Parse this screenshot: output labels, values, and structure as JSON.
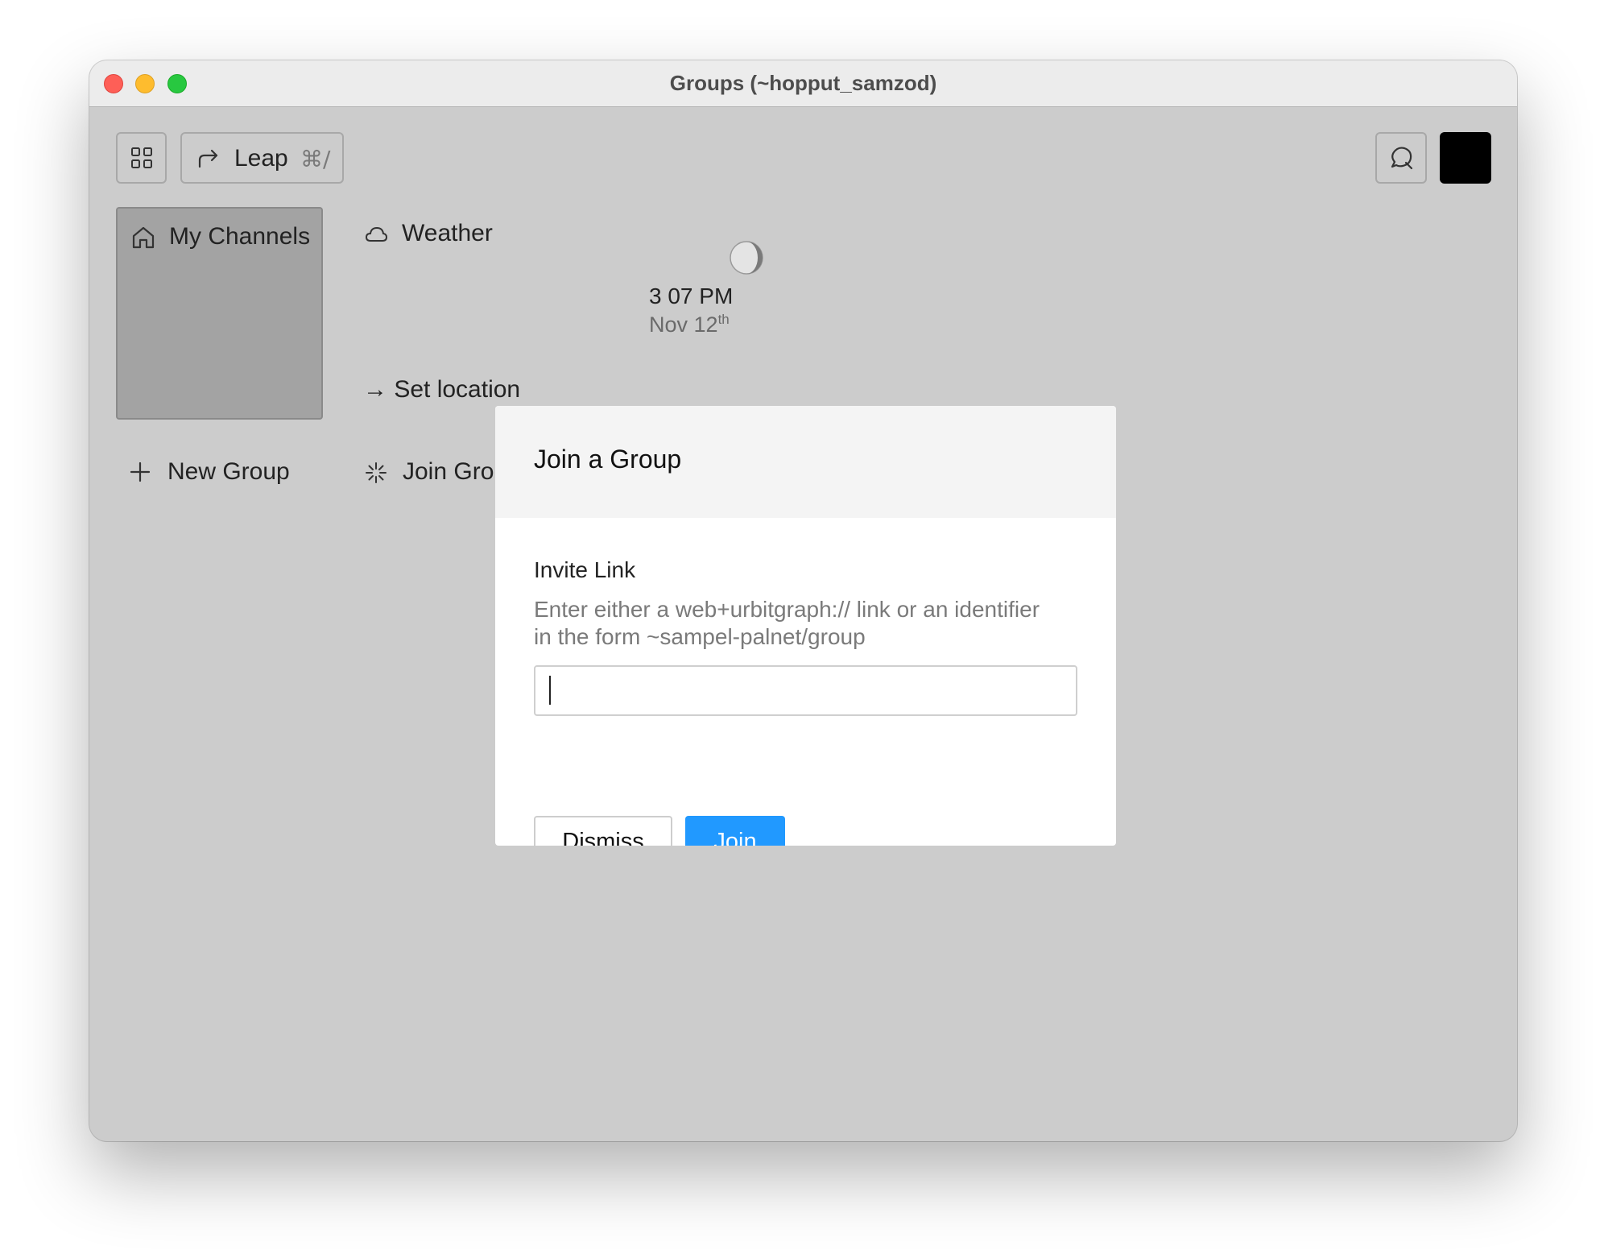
{
  "window": {
    "title": "Groups (~hopput_samzod)"
  },
  "toolbar": {
    "leap_label": "Leap",
    "leap_shortcut": "⌘/"
  },
  "tiles": {
    "my_channels": "My Channels",
    "weather": {
      "label": "Weather",
      "time": "3 07 PM",
      "date": "Nov 12",
      "date_suffix": "th",
      "set_location": "→ Set location"
    },
    "new_group": "New Group",
    "join_group": "Join Group"
  },
  "modal": {
    "title": "Join a Group",
    "field_label": "Invite Link",
    "help_text": "Enter either a web+urbitgraph:// link or an identifier in the form ~sampel-palnet/group",
    "input_value": "",
    "input_placeholder": "",
    "dismiss_label": "Dismiss",
    "join_label": "Join"
  },
  "colors": {
    "accent": "#2199ff",
    "background": "#cccccc",
    "tile_active": "#a3a3a3"
  },
  "icons": [
    "grid-icon",
    "leap-arrow-icon",
    "notification-icon",
    "home-icon",
    "cloud-icon",
    "moon-icon",
    "plus-icon",
    "sparkle-icon"
  ]
}
